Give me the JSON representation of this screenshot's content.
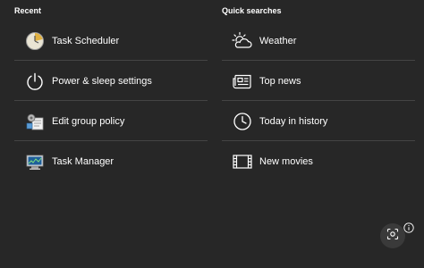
{
  "recent": {
    "title": "Recent",
    "items": [
      {
        "label": "Task Scheduler",
        "icon": "task-scheduler-icon"
      },
      {
        "label": "Power & sleep settings",
        "icon": "power-icon"
      },
      {
        "label": "Edit group policy",
        "icon": "group-policy-icon"
      },
      {
        "label": "Task Manager",
        "icon": "task-manager-icon"
      }
    ]
  },
  "quick_searches": {
    "title": "Quick searches",
    "items": [
      {
        "label": "Weather",
        "icon": "weather-icon"
      },
      {
        "label": "Top news",
        "icon": "news-icon"
      },
      {
        "label": "Today in history",
        "icon": "clock-icon"
      },
      {
        "label": "New movies",
        "icon": "film-icon"
      }
    ]
  },
  "footer": {
    "lens_icon": "screenshot-lens-icon",
    "info_icon": "info-icon"
  },
  "colors": {
    "background": "#272727",
    "divider": "#444444",
    "text": "#ffffff"
  }
}
